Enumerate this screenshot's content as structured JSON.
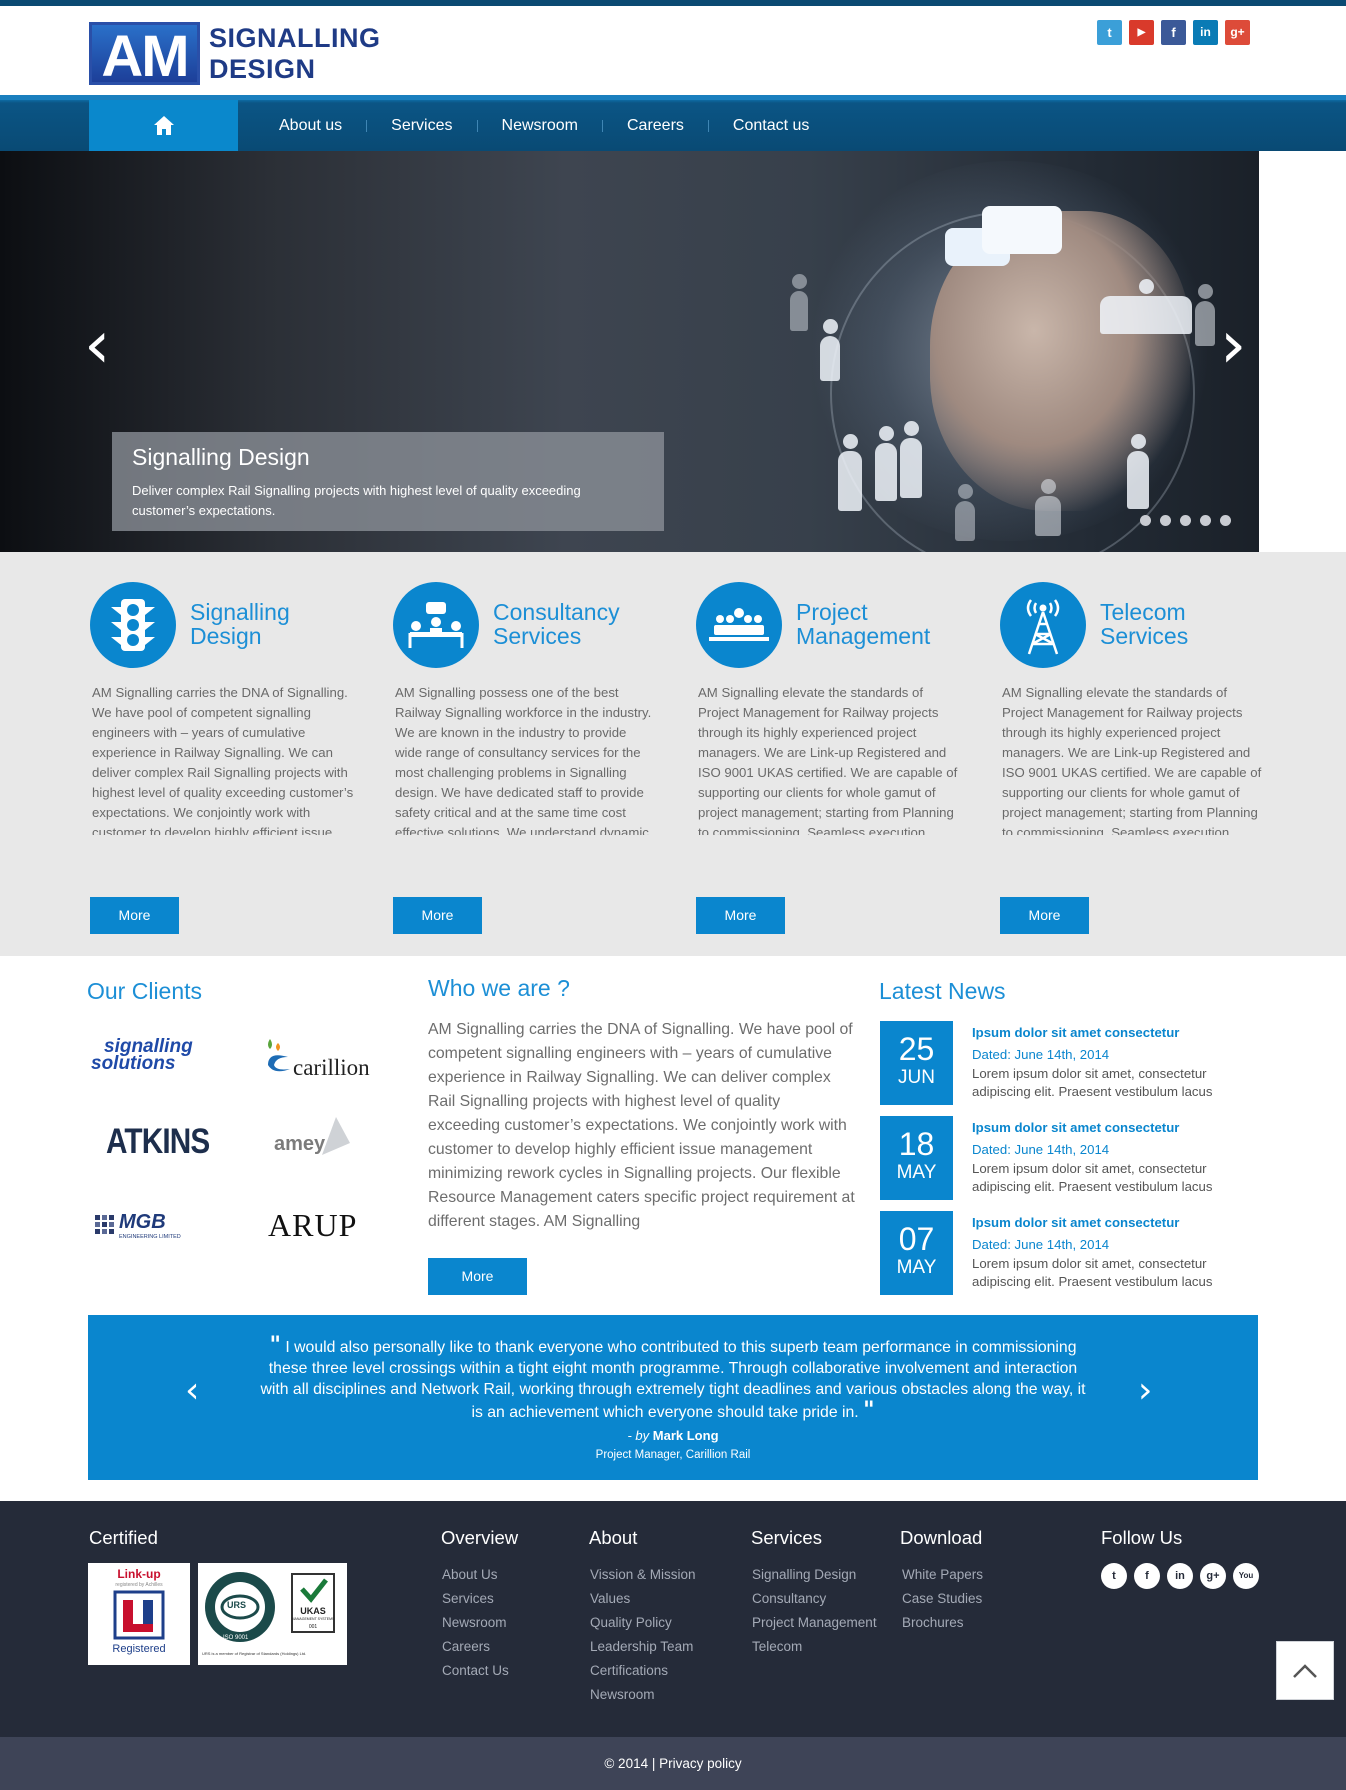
{
  "brand": {
    "logo_mark": "AM",
    "logo_line1": "SIGNALLING",
    "logo_line2": "DESIGN"
  },
  "social_top": [
    {
      "icon": "twitter-icon",
      "glyph": "t",
      "color": "#3b9fd8"
    },
    {
      "icon": "youtube-icon",
      "glyph": "▶",
      "color": "#d93a2b"
    },
    {
      "icon": "facebook-icon",
      "glyph": "f",
      "color": "#3b5998"
    },
    {
      "icon": "linkedin-icon",
      "glyph": "in",
      "color": "#0a7bb5"
    },
    {
      "icon": "google-plus-icon",
      "glyph": "g+",
      "color": "#dd4b39"
    }
  ],
  "nav": {
    "home_icon": "home-icon",
    "items": [
      "About us",
      "Services",
      "Newsroom",
      "Careers",
      "Contact us"
    ]
  },
  "hero": {
    "caption_title": "Signalling Design",
    "caption_text": "Deliver complex Rail Signalling projects with highest level of quality exceeding customer’s expectations.",
    "slide_count": 5,
    "prev_glyph": "‹",
    "next_glyph": "›"
  },
  "services": [
    {
      "title_line1": "Signalling",
      "title_line2": "Design",
      "icon": "traffic-light-icon",
      "text": "AM Signalling carries the DNA of Signalling. We have pool of competent signalling engineers with – years of cumulative experience in Railway Signalling. We can deliver complex Rail Signalling projects with highest level of quality exceeding customer’s expectations. We conjointly work with customer to develop highly efficient issue management minimizing rework cycles in",
      "button": "More"
    },
    {
      "title_line1": "Consultancy",
      "title_line2": "Services",
      "icon": "meeting-icon",
      "text": "AM Signalling possess one of the best Railway Signalling workforce in the industry. We are known in the industry to provide wide range of consultancy services for the most challenging problems in Signalling design. We have dedicated staff to provide safety critical and at the same time cost effective solutions. We understand dynamic nature of Signalling projects and help client",
      "button": "More"
    },
    {
      "title_line1": "Project",
      "title_line2": "Management",
      "icon": "team-icon",
      "text": "AM Signalling elevate the standards of Project Management for Railway projects through its highly experienced project managers. We are Link-up Registered and ISO 9001 UKAS certified. We are capable of supporting our clients for whole gamut of project management; starting from Planning to commissioning. Seamless execution project is by umbrella of well-defined processes",
      "button": "More"
    },
    {
      "title_line1": "Telecom",
      "title_line2": "Services",
      "icon": "antenna-tower-icon",
      "text": "AM Signalling elevate the standards of Project Management for Railway projects through its highly experienced project managers. We are Link-up Registered and ISO 9001 UKAS certified. We are capable of supporting our clients for whole gamut of project management; starting from Planning to commissioning. Seamless execution project is by umbrella of well-defined processes",
      "button": "More"
    }
  ],
  "clients": {
    "heading": "Our Clients",
    "logos": {
      "signalling_solutions_1": "signalling",
      "signalling_solutions_2": "solutions",
      "carillion": "carillion",
      "atkins": "ATKINS",
      "amey": "amey",
      "mgb": "MGB",
      "mgb_sub": "ENGINEERING LIMITED",
      "arup": "ARUP"
    }
  },
  "who": {
    "heading": "Who we are ?",
    "text": "AM Signalling carries the DNA of Signalling. We have pool of competent signalling engineers with – years of cumulative experience in Railway Signalling.  We can deliver complex Rail Signalling projects with highest level of quality exceeding customer’s expectations. We conjointly work with customer to develop highly efficient issue management minimizing rework cycles in Signalling projects. Our flexible Resource Management caters specific project requirement at different stages.  AM Signalling",
    "button": "More"
  },
  "news": {
    "heading": "Latest News",
    "items": [
      {
        "day": "25",
        "month": "JUN",
        "title": "Ipsum dolor sit amet consectetur",
        "dated": "Dated: June 14th, 2014",
        "body": "Lorem ipsum dolor sit amet, consectetur adipiscing elit. Praesent vestibulum lacus"
      },
      {
        "day": "18",
        "month": "MAY",
        "title": "Ipsum dolor sit amet consectetur",
        "dated": "Dated: June 14th, 2014",
        "body": "Lorem ipsum dolor sit amet, consectetur adipiscing elit. Praesent vestibulum lacus"
      },
      {
        "day": "07",
        "month": "MAY",
        "title": "Ipsum dolor sit amet consectetur",
        "dated": "Dated: June 14th, 2014",
        "body": "Lorem ipsum dolor sit amet, consectetur adipiscing elit. Praesent vestibulum lacus"
      }
    ]
  },
  "testimonial": {
    "quote": "I would also personally like to thank everyone who contributed to this superb team performance in commissioning these three level crossings within a tight eight month programme. Through collaborative involvement and interaction with all disciplines and Network Rail, working through extremely tight deadlines and various obstacles along the way, it is an achievement which everyone should take pride in.",
    "open_mark": "\"",
    "close_mark": "\"",
    "by": "- by",
    "author": "Mark Long",
    "role": "Project Manager,  Carillion Rail",
    "prev_glyph": "‹",
    "next_glyph": "›"
  },
  "footer": {
    "certified": "Certified",
    "cert_linkup_top": "Link-up",
    "cert_linkup_sub": "registered by Achilles",
    "cert_linkup_bottom": "Registered",
    "cert_urs": "URS",
    "cert_iso": "ISO 9001",
    "cert_ukas": "UKAS",
    "cert_ukas_sub": "MANAGEMENT SYSTEMS",
    "cert_ukas_num": "001",
    "cert_urs_note": "URS is a member of Registrar of Standards (Holdings) Ltd.",
    "columns": [
      {
        "heading": "Overview",
        "links": [
          "About Us",
          "Services",
          "Newsroom",
          "Careers",
          "Contact Us"
        ]
      },
      {
        "heading": "About",
        "links": [
          "Vission & Mission",
          "Values",
          "Quality Policy",
          "Leadership Team",
          "Certifications",
          "Newsroom"
        ]
      },
      {
        "heading": "Services",
        "links": [
          "Signalling Design",
          "Consultancy",
          "Project Management",
          "Telecom"
        ]
      },
      {
        "heading": "Download",
        "links": [
          "White Papers",
          "Case Studies",
          "Brochures"
        ]
      }
    ],
    "follow_us": "Follow Us",
    "social": [
      {
        "icon": "twitter-icon",
        "glyph": "t"
      },
      {
        "icon": "facebook-icon",
        "glyph": "f"
      },
      {
        "icon": "linkedin-icon",
        "glyph": "in"
      },
      {
        "icon": "google-plus-icon",
        "glyph": "g+"
      },
      {
        "icon": "youtube-icon",
        "glyph": "You"
      }
    ],
    "copyright": "© 2014 | Privacy policy"
  },
  "colors": {
    "accent": "#0a86ce",
    "nav": "#094a74",
    "footer": "#252b39",
    "copyright_bar": "#3e4457"
  }
}
